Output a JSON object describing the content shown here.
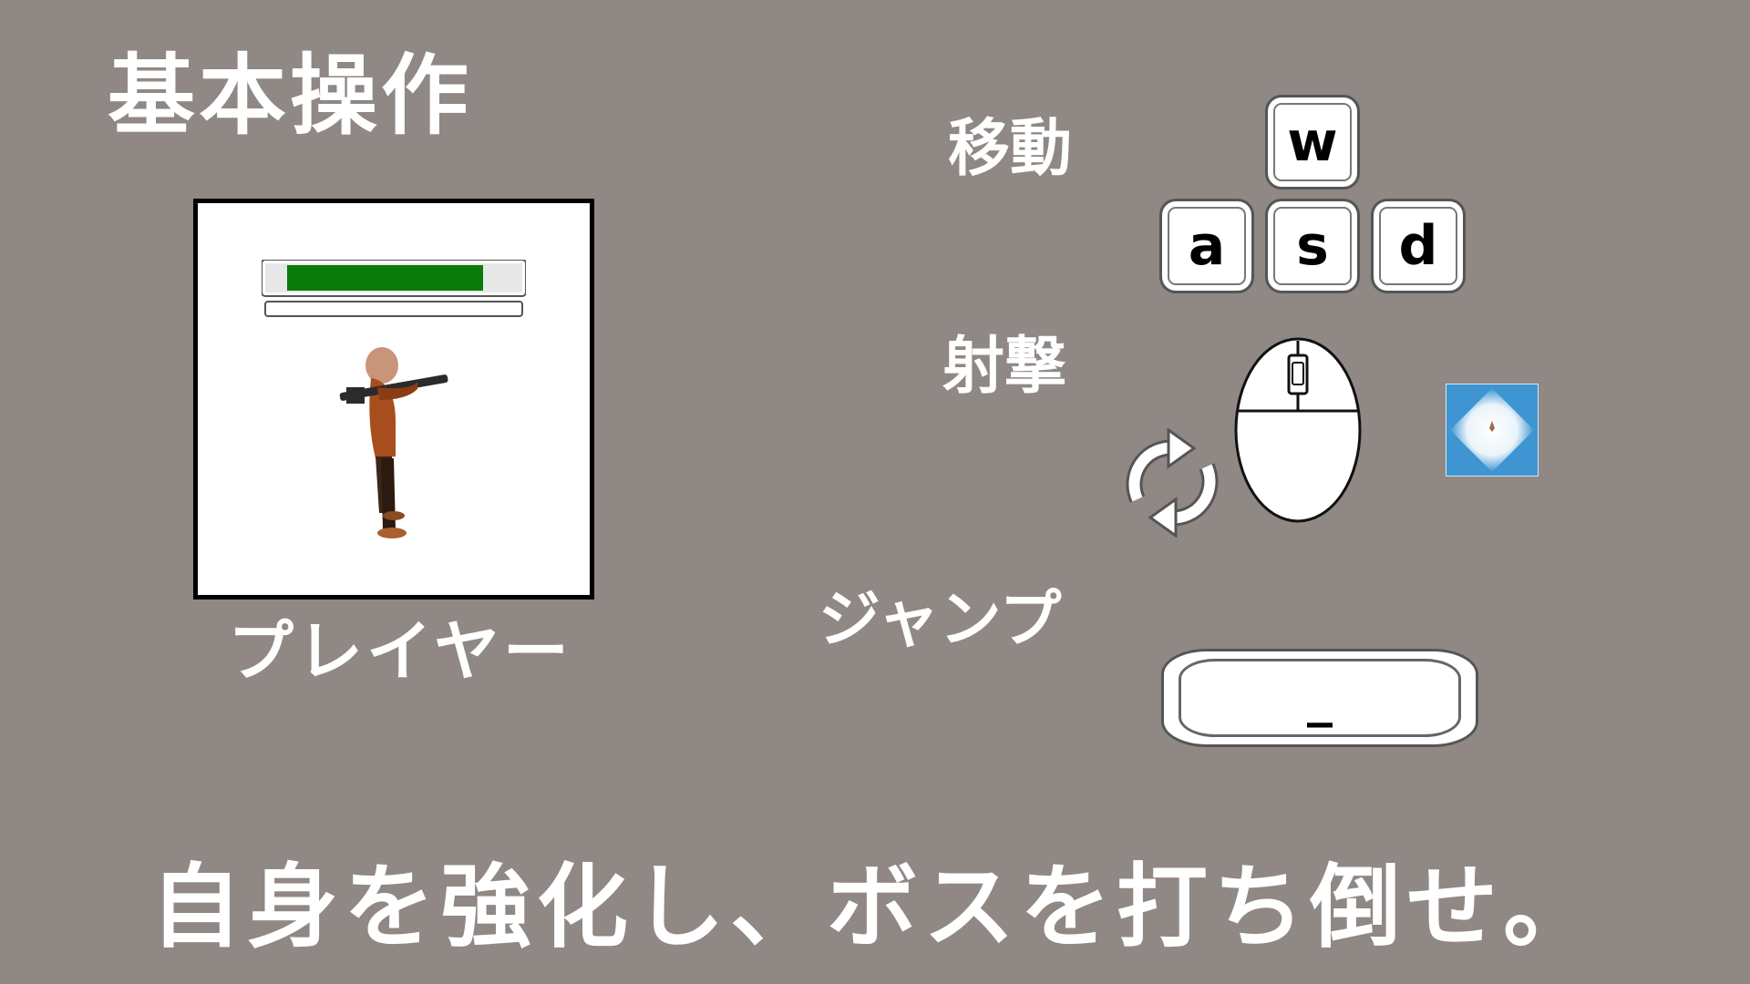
{
  "screen_title": "基本操作",
  "player": {
    "label": "プレイヤー",
    "health_fraction": 0.92,
    "health_color": "#0a7a0a"
  },
  "controls": {
    "move": {
      "label": "移動",
      "keys": [
        "w",
        "a",
        "s",
        "d"
      ]
    },
    "shoot": {
      "label": "射撃",
      "icons": [
        "mouse-icon",
        "rotate-arrows-icon",
        "crosshair-icon"
      ]
    },
    "jump": {
      "label": "ジャンプ",
      "key": "_"
    }
  },
  "slogan": "自身を強化し、ボスを打ち倒せ。",
  "colors": {
    "background": "#8f8884",
    "text": "#ffffff",
    "crosshair_bg": "#3e95d1"
  }
}
